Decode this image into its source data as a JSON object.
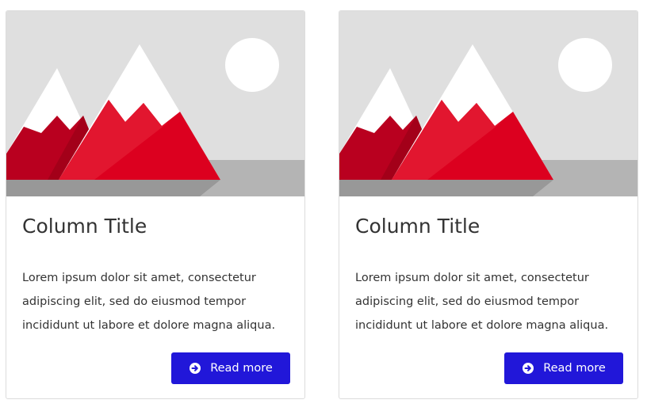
{
  "cards": [
    {
      "image_icon": "mountain-landscape-placeholder",
      "title": "Column Title",
      "text": "Lorem ipsum dolor sit amet, consectetur adipiscing elit, sed do eiusmod tempor incididunt ut labore et dolore magna aliqua.",
      "button_label": "Read more",
      "button_icon": "arrow-circle-right-icon"
    },
    {
      "image_icon": "mountain-landscape-placeholder",
      "title": "Column Title",
      "text": "Lorem ipsum dolor sit amet, consectetur adipiscing elit, sed do eiusmod tempor incididunt ut labore et dolore magna aliqua.",
      "button_label": "Read more",
      "button_icon": "arrow-circle-right-icon"
    }
  ],
  "colors": {
    "button": "#2117d9",
    "mountain_red": "#dc001f",
    "sky": "#dfdfdf",
    "ground": "#b4b4b4"
  }
}
